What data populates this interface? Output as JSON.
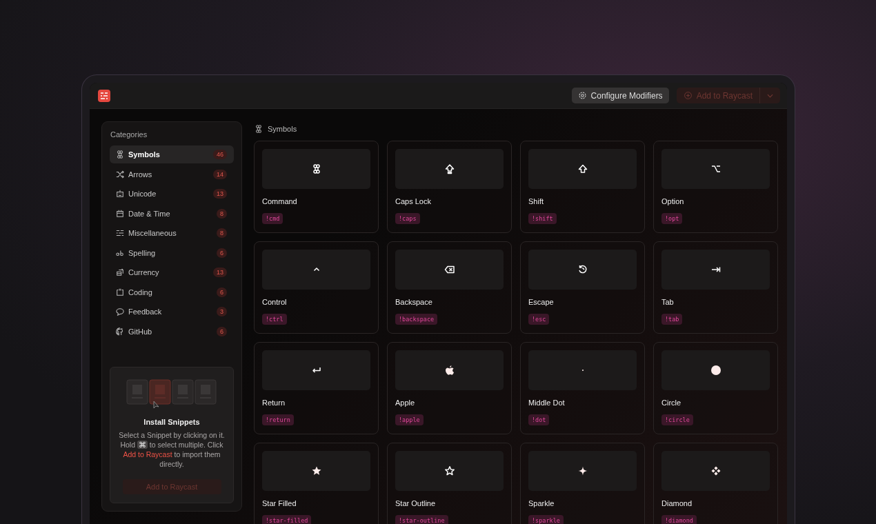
{
  "toolbar": {
    "configure_button": {
      "label": "Configure Modifiers"
    },
    "add_button": {
      "label": "Add to Raycast",
      "disabled": true
    }
  },
  "sidebar": {
    "title": "Categories",
    "items": [
      {
        "label": "Symbols",
        "count": "46",
        "selected": true
      },
      {
        "label": "Arrows",
        "count": "14",
        "selected": false
      },
      {
        "label": "Unicode",
        "count": "13",
        "selected": false
      },
      {
        "label": "Date & Time",
        "count": "8",
        "selected": false
      },
      {
        "label": "Miscellaneous",
        "count": "8",
        "selected": false
      },
      {
        "label": "Spelling",
        "count": "6",
        "selected": false
      },
      {
        "label": "Currency",
        "count": "13",
        "selected": false
      },
      {
        "label": "Coding",
        "count": "6",
        "selected": false
      },
      {
        "label": "Feedback",
        "count": "3",
        "selected": false
      },
      {
        "label": "GitHub",
        "count": "6",
        "selected": false
      }
    ],
    "install": {
      "title": "Install Snippets",
      "description": [
        {
          "kind": "text",
          "text": "Select a Snippet by clicking on it. Hold "
        },
        {
          "kind": "key",
          "text": "⌘"
        },
        {
          "kind": "text",
          "text": " to select multiple. Click "
        },
        {
          "kind": "link",
          "text": "Add to Raycast"
        },
        {
          "kind": "text",
          "text": " to import them directly."
        }
      ],
      "button": {
        "label": "Add to Raycast",
        "disabled": true
      }
    }
  },
  "content": {
    "heading": "Symbols",
    "snippets": [
      {
        "name": "Command",
        "keyword": "!cmd"
      },
      {
        "name": "Caps Lock",
        "keyword": "!caps"
      },
      {
        "name": "Shift",
        "keyword": "!shift"
      },
      {
        "name": "Option",
        "keyword": "!opt"
      },
      {
        "name": "Control",
        "keyword": "!ctrl"
      },
      {
        "name": "Backspace",
        "keyword": "!backspace"
      },
      {
        "name": "Escape",
        "keyword": "!esc"
      },
      {
        "name": "Tab",
        "keyword": "!tab"
      },
      {
        "name": "Return",
        "keyword": "!return"
      },
      {
        "name": "Apple",
        "keyword": "!apple"
      },
      {
        "name": "Middle Dot",
        "keyword": "!dot"
      },
      {
        "name": "Circle",
        "keyword": "!circle"
      },
      {
        "name": "Star Filled",
        "keyword": "!star-filled"
      },
      {
        "name": "Star Outline",
        "keyword": "!star-outline"
      },
      {
        "name": "Sparkle",
        "keyword": "!sparkle"
      },
      {
        "name": "Diamond",
        "keyword": "!diamond"
      }
    ]
  }
}
